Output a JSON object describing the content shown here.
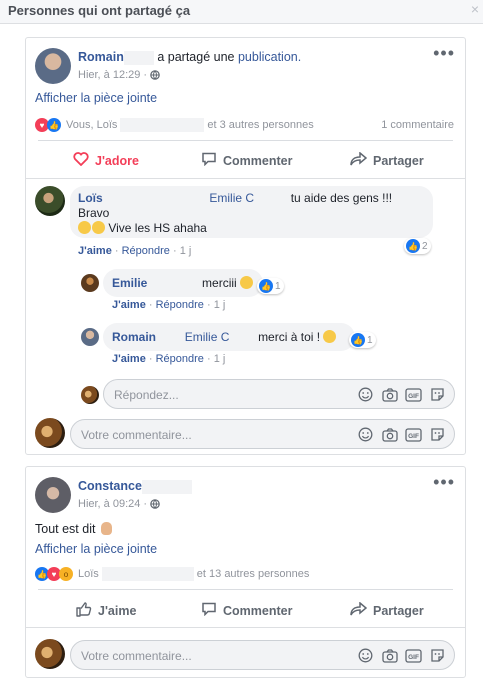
{
  "dialog": {
    "title": "Personnes qui ont partagé ça",
    "close": "×"
  },
  "post1": {
    "author": "Romain",
    "shared_text": "a partagé une",
    "shared_link": "publication.",
    "time": "Hier, à 12:29 · ",
    "attachment_link": "Afficher la pièce jointe",
    "reactions_text_prefix": "Vous, Loïs",
    "reactions_text_suffix": "et 3 autres personnes",
    "comment_count": "1 commentaire",
    "actions": {
      "love": "J'adore",
      "comment": "Commenter",
      "share": "Partager"
    },
    "comments": [
      {
        "author": "Loïs",
        "mention": "Emilie C",
        "text_line1": "tu aide des gens !!!",
        "text_line2": "Bravo",
        "text_line3": "Vive les HS ahaha",
        "like": "J'aime",
        "reply": "Répondre",
        "age": "1 j",
        "reaction_count": "2"
      }
    ],
    "replies": [
      {
        "author": "Emilie",
        "text": "merciii",
        "like": "J'aime",
        "reply": "Répondre",
        "age": "1 j",
        "reaction_count": "1"
      },
      {
        "author": "Romain",
        "mention": "Emilie C",
        "text": "merci à toi !",
        "like": "J'aime",
        "reply": "Répondre",
        "age": "1 j",
        "reaction_count": "1"
      }
    ],
    "reply_placeholder": "Répondez...",
    "comment_placeholder": "Votre commentaire..."
  },
  "post2": {
    "author": "Constance",
    "time": "Hier, à 09:24 · ",
    "body": "Tout est dit",
    "attachment_link": "Afficher la pièce jointe",
    "reactions_text_prefix": "Loïs",
    "reactions_text_suffix": "et 13 autres personnes",
    "actions": {
      "like": "J'aime",
      "comment": "Commenter",
      "share": "Partager"
    },
    "comment_placeholder": "Votre commentaire..."
  },
  "icons": [
    "close-icon",
    "globe-icon",
    "more-options-icon",
    "love-icon",
    "comment-icon",
    "share-icon",
    "like-icon",
    "emoji-icon",
    "camera-icon",
    "gif-icon",
    "sticker-icon"
  ],
  "colors": {
    "link": "#365899",
    "love": "#f33e58",
    "like": "#1877f2",
    "muted": "#90949c"
  },
  "gif_label": "GIF"
}
